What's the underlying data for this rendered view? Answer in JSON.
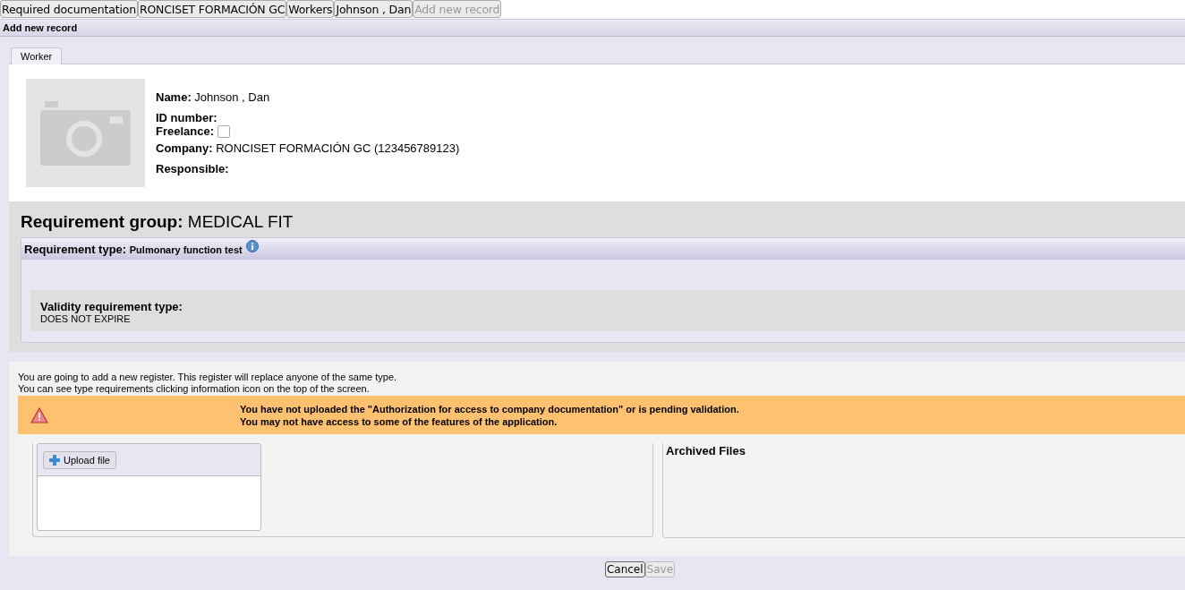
{
  "breadcrumbs": [
    {
      "label": "Required documentation",
      "disabled": false
    },
    {
      "label": "RONCISET FORMACIÓN GC",
      "disabled": false
    },
    {
      "label": "Workers",
      "disabled": false
    },
    {
      "label": "Johnson , Dan",
      "disabled": false
    },
    {
      "label": "Add new record",
      "disabled": true
    }
  ],
  "header": {
    "title": "Add new record"
  },
  "tabs": [
    {
      "label": "Worker",
      "selected": true
    }
  ],
  "worker": {
    "fields": [
      {
        "label": "Name:",
        "value": "Johnson , Dan"
      },
      {
        "label": "ID number:"
      },
      {
        "label": "Freelance:",
        "kind": "checkbox",
        "checked": false
      },
      {
        "label": "Company:",
        "value": "RONCISET FORMACIÓN GC (123456789123)"
      },
      {
        "label": "Responsible:"
      }
    ]
  },
  "requirement": {
    "group_label": "Requirement group:",
    "group_value": "MEDICAL FIT",
    "type_label": "Requirement type:",
    "type_value": "Pulmonary function test",
    "validity_label": "Validity requirement type:",
    "validity_value": "DOES NOT EXPIRE"
  },
  "notes": [
    "You are going to add a new register. This register will replace anyone of the same type.",
    "You can see type requirements clicking information icon on the top of the screen."
  ],
  "warning": [
    "You have not uploaded the \"Authorization for access to company documentation\" or is pending validation.",
    "You may not have access to some of the features of the application."
  ],
  "upload": {
    "button": "Upload file"
  },
  "archived": {
    "title": "Archived Files"
  },
  "actions": [
    {
      "label": "Cancel",
      "disabled": false
    },
    {
      "label": "Save",
      "disabled": true
    }
  ]
}
